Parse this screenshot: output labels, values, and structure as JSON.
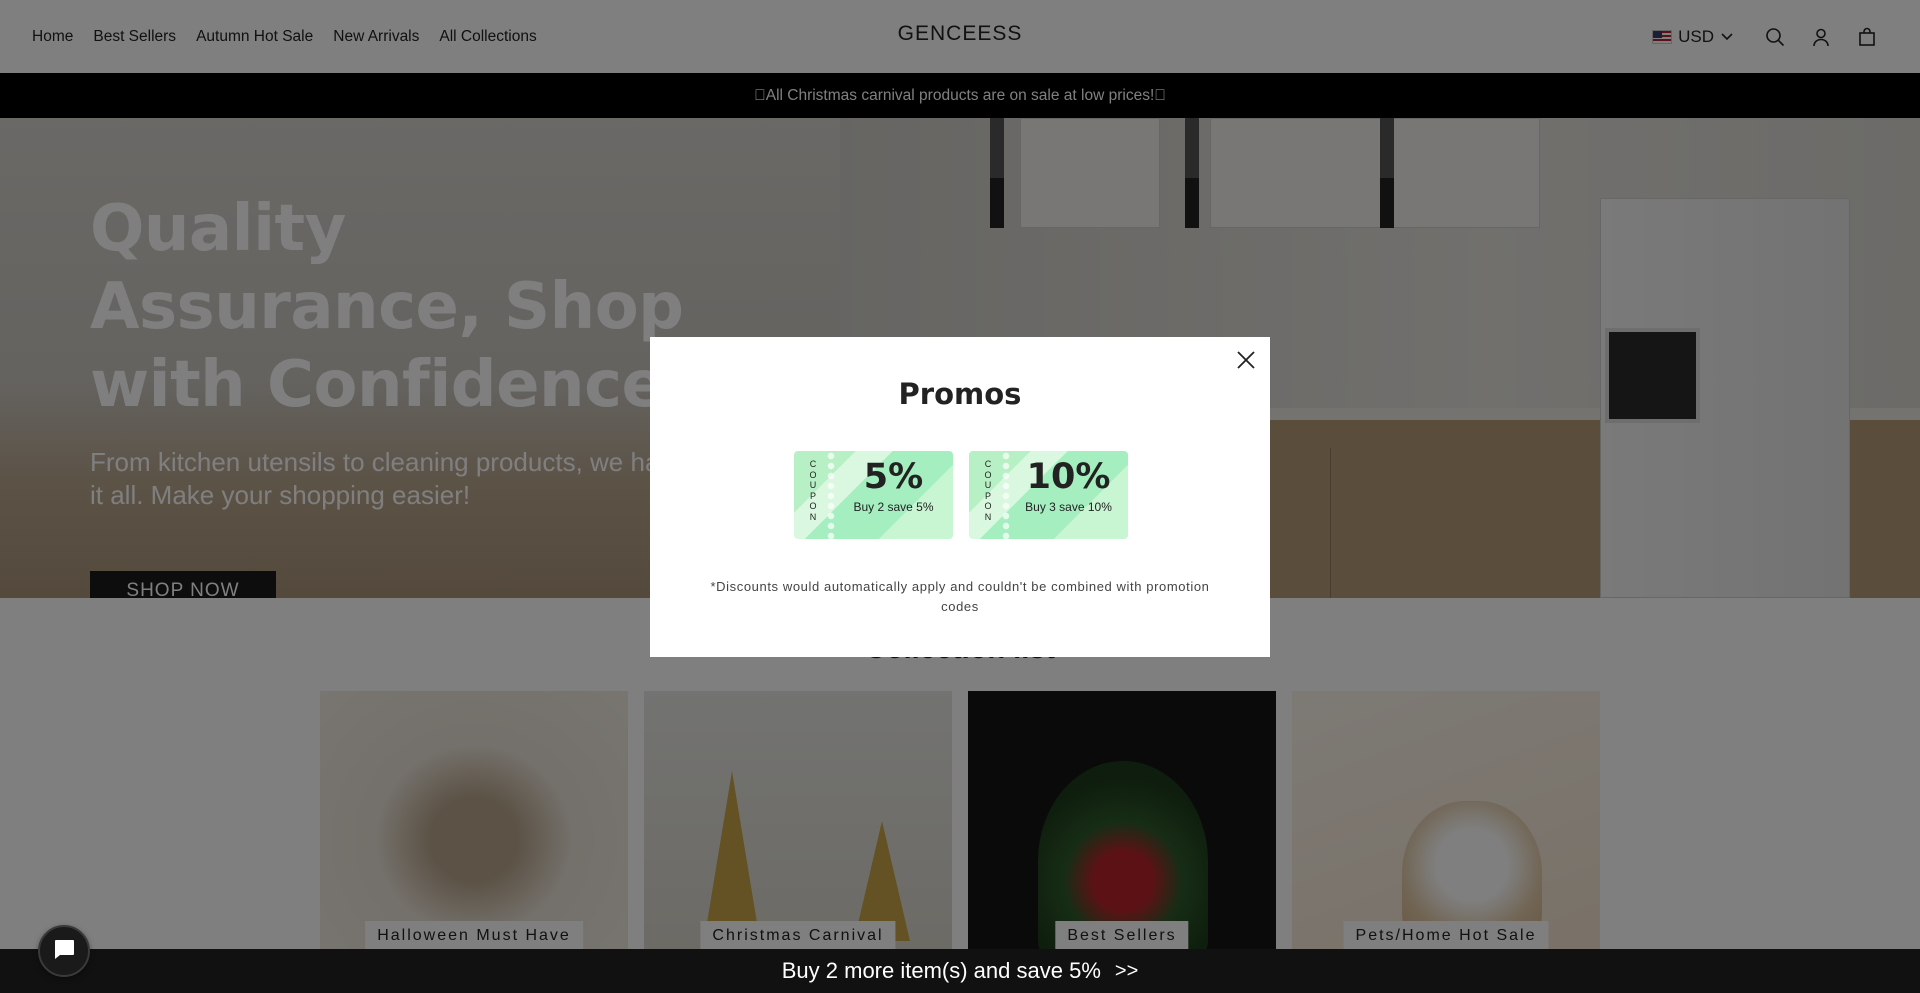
{
  "header": {
    "nav": [
      "Home",
      "Best Sellers",
      "Autumn Hot Sale",
      "New Arrivals",
      "All Collections"
    ],
    "brand": "GENCEESS",
    "currency": "USD"
  },
  "announcement": "\u0000All Christmas carnival products are on sale at low prices!\u0000",
  "hero": {
    "title": "Quality Assurance, Shop with Confidence",
    "subtitle": "From kitchen utensils to cleaning products, we have it all. Make your shopping easier!",
    "button": "SHOP NOW"
  },
  "collection": {
    "title": "Collection list",
    "cards": [
      "Halloween Must Have",
      "Christmas Carnival",
      "Best Sellers",
      "Pets/Home Hot Sale"
    ]
  },
  "modal": {
    "title": "Promos",
    "coupon_side_text": "COUPON",
    "coupons": [
      {
        "value": "5%",
        "desc": "Buy 2 save 5%"
      },
      {
        "value": "10%",
        "desc": "Buy 3 save 10%"
      }
    ],
    "note": "*Discounts would automatically apply and couldn't be combined with promotion codes"
  },
  "bottom_bar": {
    "text": "Buy 2 more item(s) and save 5%",
    "arrows": ">>"
  },
  "colors": {
    "coupon_green": "#b8f0c6",
    "announcement_bg": "#000000",
    "overlay": "rgba(0,0,0,0.5)"
  },
  "icons": [
    "us-flag-icon",
    "chevron-down-icon",
    "search-icon",
    "account-icon",
    "cart-icon",
    "close-icon",
    "chat-icon"
  ]
}
